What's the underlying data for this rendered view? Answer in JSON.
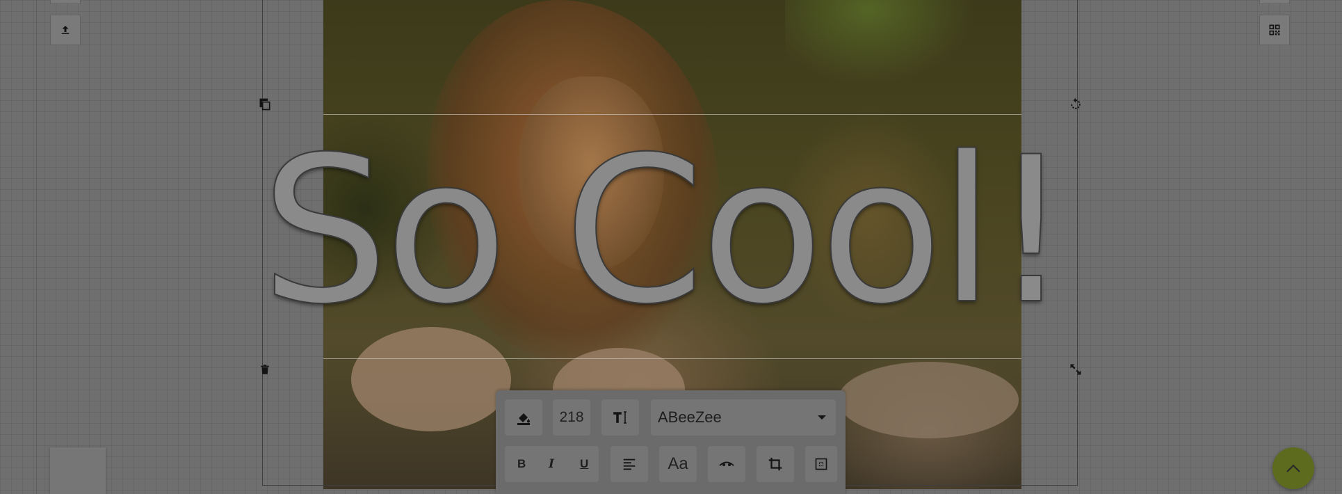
{
  "colors": {
    "overlay": "#6f6f6f",
    "toolbar_bg": "#6b6b6b",
    "button_bg": "#757575",
    "scroll_top_button": "#5d6b1f",
    "text_fill": "#8a8a8a"
  },
  "canvas": {
    "text_object": "So Cool!",
    "photo": {
      "subject": "lion photo"
    }
  },
  "side_buttons": {
    "upload_icon": "upload-icon",
    "qr_icon": "qr-code-icon"
  },
  "handles": {
    "copy": "copy-icon",
    "rotate": "rotate-icon",
    "delete": "trash-icon",
    "resize": "resize-icon"
  },
  "toolbar": {
    "fill_color_icon": "paint-bucket-icon",
    "font_size": "218",
    "text_height_icon": "text-height-icon",
    "font_family": "ABeeZee",
    "bold": "B",
    "italic": "I",
    "underline": "U",
    "align_icon": "align-left-icon",
    "case_label": "Aa",
    "curve_icon": "text-curve-icon",
    "crop_icon": "crop-icon",
    "padding_icon": "padding-icon"
  },
  "scroll_top_icon": "chevron-up-icon"
}
